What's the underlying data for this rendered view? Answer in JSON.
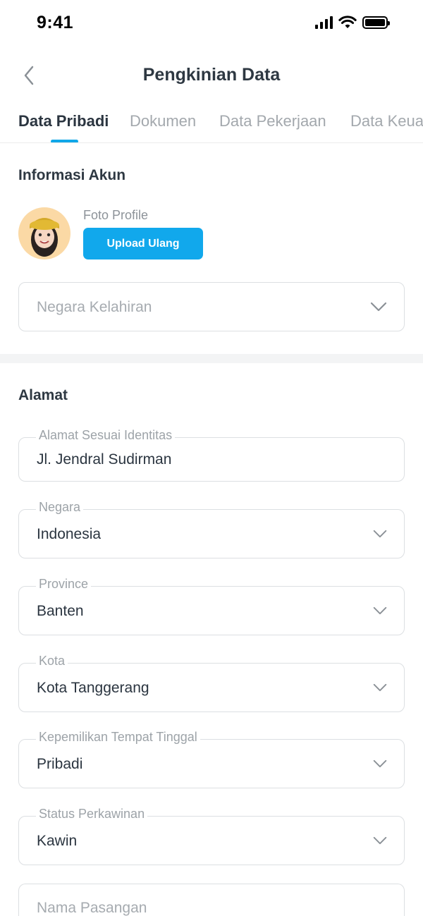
{
  "status_bar": {
    "time": "9:41"
  },
  "header": {
    "title": "Pengkinian Data",
    "back_icon": "chevron-left-icon"
  },
  "tabs": [
    {
      "label": "Data Pribadi",
      "active": true
    },
    {
      "label": "Dokumen",
      "active": false
    },
    {
      "label": "Data Pekerjaan",
      "active": false
    },
    {
      "label": "Data Keua",
      "active": false
    }
  ],
  "colors": {
    "accent": "#10a7e8",
    "button": "#11a8ec",
    "text": "#2b3540",
    "muted": "#a3a8ad"
  },
  "informasi_akun": {
    "title": "Informasi Akun",
    "foto_label": "Foto Profile",
    "upload_label": "Upload Ulang",
    "negara_kelahiran_placeholder": "Negara Kelahiran"
  },
  "alamat": {
    "title": "Alamat",
    "fields": {
      "alamat_identitas": {
        "label": "Alamat Sesuai Identitas",
        "value": "Jl. Jendral Sudirman"
      },
      "negara": {
        "label": "Negara",
        "value": "Indonesia"
      },
      "province": {
        "label": "Province",
        "value": "Banten"
      },
      "kota": {
        "label": "Kota",
        "value": "Kota Tanggerang"
      },
      "kepemilikan": {
        "label": "Kepemilikan Tempat Tinggal",
        "value": "Pribadi"
      },
      "status_perkawinan": {
        "label": "Status Perkawinan",
        "value": "Kawin"
      }
    },
    "nama_pasangan_placeholder": "Nama Pasangan"
  }
}
